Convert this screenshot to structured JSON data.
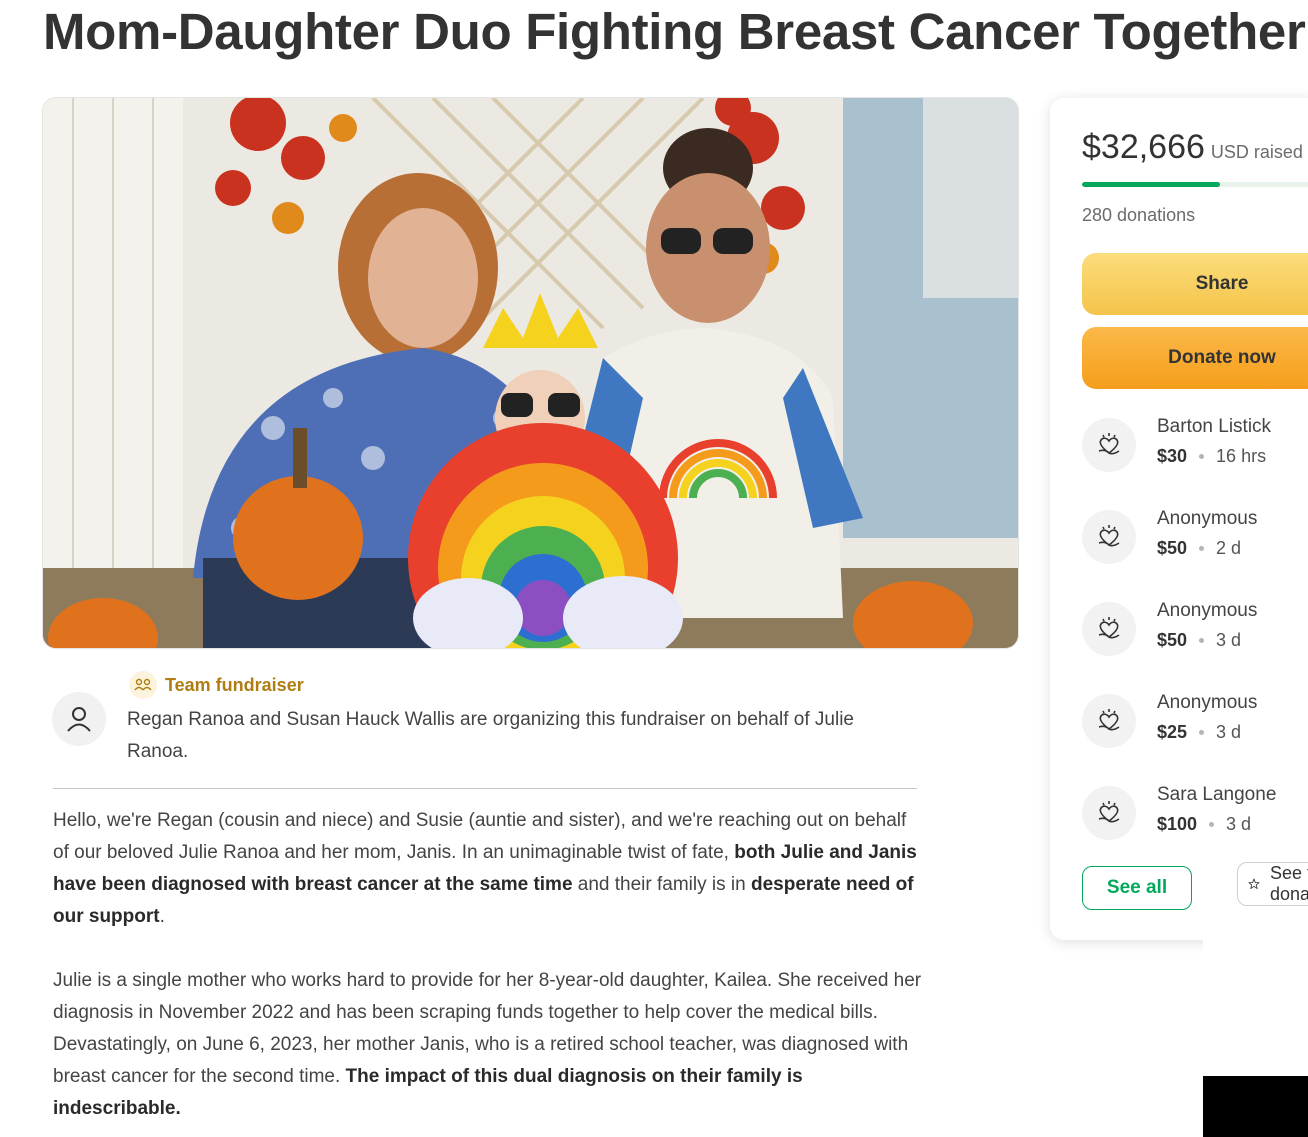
{
  "title": "Mom-Daughter Duo Fighting Breast Cancer Together",
  "hero_image": {
    "icon": "family-photo"
  },
  "organizer": {
    "badge_label": "Team fundraiser",
    "text": "Regan Ranoa and Susan Hauck Wallis are organizing this fundraiser on behalf of Julie Ranoa."
  },
  "story": {
    "p1": {
      "a": "Hello, we're Regan (cousin and niece) and Susie (auntie and sister), and we're reaching out on behalf of our beloved Julie Ranoa and her mom, Janis. In an unimaginable twist of fate, ",
      "b": "both Julie and Janis have been diagnosed with breast cancer at the same time",
      "c": " and their family is in ",
      "d": "desperate need of our support",
      "e": "."
    },
    "p2": {
      "a": "Julie is a single mother who works hard to provide for her 8-year-old daughter, Kailea. She received her diagnosis in November 2022 and has been scraping funds together to help cover the medical bills. Devastatingly, on June 6, 2023, her mother Janis, who is a retired school teacher, was diagnosed with breast cancer for the second time. ",
      "b": "The impact of this dual diagnosis on their family is indescribable."
    }
  },
  "sidebar": {
    "raised_amount": "$32,666",
    "raised_suffix": "USD raised",
    "progress_fraction": 0.53,
    "donations_count": "280 donations",
    "share_label": "Share",
    "donate_label": "Donate now",
    "donors": [
      {
        "name": "Barton Listick",
        "amount": "$30",
        "time": "16 hrs"
      },
      {
        "name": "Anonymous",
        "amount": "$50",
        "time": "2 d"
      },
      {
        "name": "Anonymous",
        "amount": "$50",
        "time": "3 d"
      },
      {
        "name": "Anonymous",
        "amount": "$25",
        "time": "3 d"
      },
      {
        "name": "Sara Langone",
        "amount": "$100",
        "time": "3 d"
      }
    ],
    "see_all_label": "See all",
    "follow_label": "See top donations"
  },
  "colors": {
    "accent_green": "#02a95c",
    "team_gold": "#b07d12",
    "share_yellow": "#f4c44a",
    "donate_orange": "#f59e1a"
  }
}
